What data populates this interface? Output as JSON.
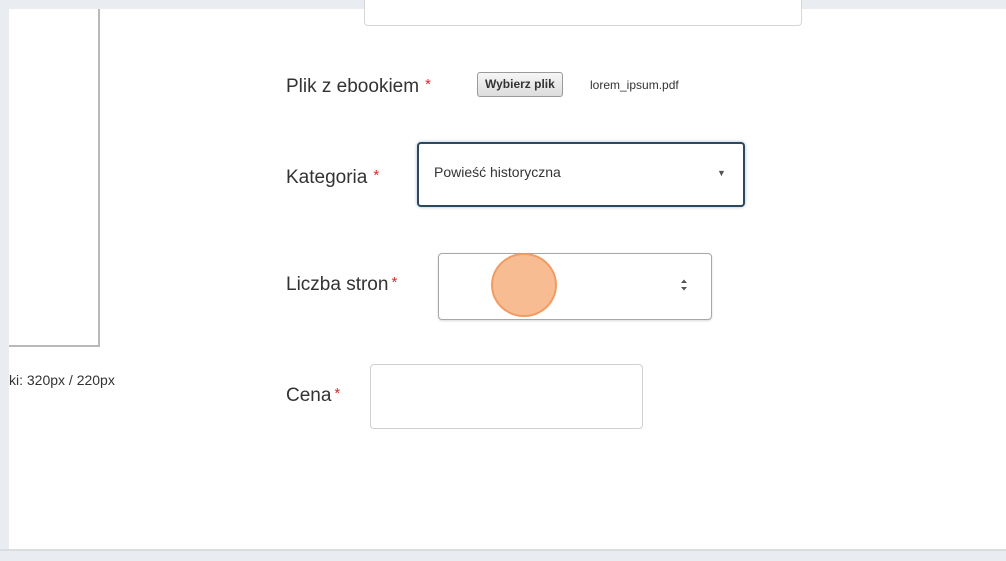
{
  "form": {
    "cover_hint": "ki: 320px / 220px",
    "file": {
      "label": "Plik z ebookiem",
      "required_mark": "*",
      "button_label": "Wybierz plik",
      "filename": "lorem_ipsum.pdf"
    },
    "category": {
      "label": "Kategoria",
      "required_mark": "*",
      "selected": "Powieść historyczna"
    },
    "pages": {
      "label": "Liczba stron",
      "required_mark": "*",
      "value": ""
    },
    "price": {
      "label": "Cena",
      "required_mark": "*",
      "value": ""
    }
  },
  "icons": {
    "select_caret": "chevron-down-icon",
    "spinner": "up-down-spinner-icon"
  },
  "colors": {
    "required": "#e2272b",
    "focus_border": "#2c4960",
    "click_marker": "#f6a56e"
  }
}
